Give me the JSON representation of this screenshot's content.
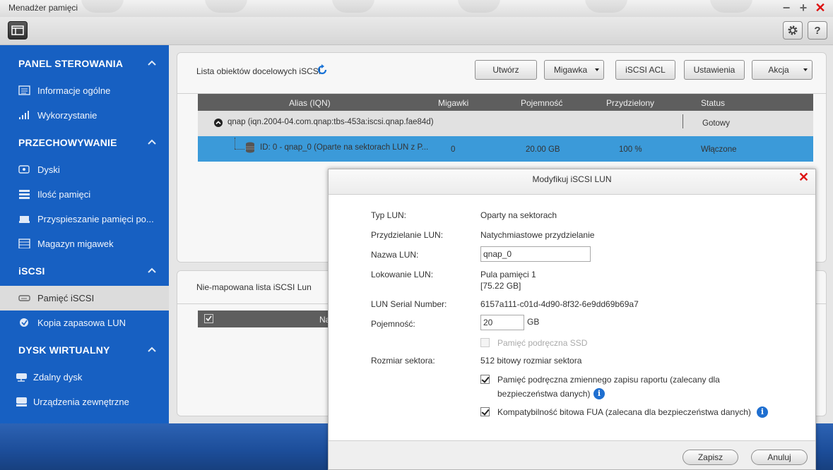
{
  "window": {
    "title": "Menadżer pamięci"
  },
  "sidebar": {
    "sections": [
      {
        "label": "PANEL STEROWANIA",
        "items": [
          {
            "label": "Informacje ogólne"
          },
          {
            "label": "Wykorzystanie"
          }
        ]
      },
      {
        "label": "PRZECHOWYWANIE",
        "items": [
          {
            "label": "Dyski"
          },
          {
            "label": "Ilość pamięci"
          },
          {
            "label": "Przyspieszanie pamięci po..."
          },
          {
            "label": "Magazyn migawek"
          }
        ]
      },
      {
        "label": "iSCSI",
        "items": [
          {
            "label": "Pamięć iSCSI"
          },
          {
            "label": "Kopia zapasowa LUN"
          }
        ]
      },
      {
        "label": "DYSK WIRTUALNY",
        "items": [
          {
            "label": "Zdalny dysk"
          },
          {
            "label": "Urządzenia zewnętrzne"
          }
        ]
      }
    ],
    "active_item": "Pamięć iSCSI"
  },
  "targets_panel": {
    "title": "Lista obiektów docelowych iSCSI",
    "buttons": {
      "create": "Utwórz",
      "snapshot": "Migawka",
      "acl": "iSCSI ACL",
      "settings": "Ustawienia",
      "action": "Akcja"
    },
    "columns": {
      "alias": "Alias (IQN)",
      "snapshots": "Migawki",
      "capacity": "Pojemność",
      "allocated": "Przydzielony",
      "status": "Status"
    },
    "target_row": {
      "alias": "qnap (iqn.2004-04.com.qnap:tbs-453a:iscsi.qnap.fae84d)",
      "status": "Gotowy"
    },
    "lun_row": {
      "alias": "ID: 0 - qnap_0 (Oparte na sektorach LUN z P...",
      "snapshots": "0",
      "capacity": "20.00 GB",
      "allocated": "100 %",
      "status": "Włączone"
    }
  },
  "unmapped_panel": {
    "title": "Nie-mapowana lista iSCSI Lun",
    "column_partial": "Na"
  },
  "modal": {
    "title": "Modyfikuj iSCSI LUN",
    "lun_type_label": "Typ LUN:",
    "lun_type_value": "Oparty na sektorach",
    "allocation_label": "Przydzielanie LUN:",
    "allocation_value": "Natychmiastowe przydzielanie",
    "name_label": "Nazwa LUN:",
    "name_value": "qnap_0",
    "location_label": "Lokowanie LUN:",
    "location_value_line1": "Pula pamięci 1",
    "location_value_line2": "[75.22 GB]",
    "serial_label": "LUN Serial Number:",
    "serial_value": "6157a111-c01d-4d90-8f32-6e9dd69b69a7",
    "capacity_label": "Pojemność:",
    "capacity_value": "20",
    "capacity_unit": "GB",
    "ssd_cache_label": "Pamięć podręczna SSD",
    "sector_size_label": "Rozmiar sektora:",
    "sector_size_value": "512 bitowy rozmiar sektora",
    "write_cache_label_line1": "Pamięć podręczna zmiennego zapisu raportu (zalecany dla",
    "write_cache_label_line2": "bezpieczeństwa danych)",
    "fua_label": "Kompatybilność bitowa FUA (zalecana dla bezpieczeństwa danych)",
    "save_label": "Zapisz",
    "cancel_label": "Anuluj"
  },
  "colors": {
    "sidebar": "#1760c2",
    "selected_row": "#3b9ad9",
    "close_red": "#d11111",
    "info_blue": "#1f6fd0"
  }
}
